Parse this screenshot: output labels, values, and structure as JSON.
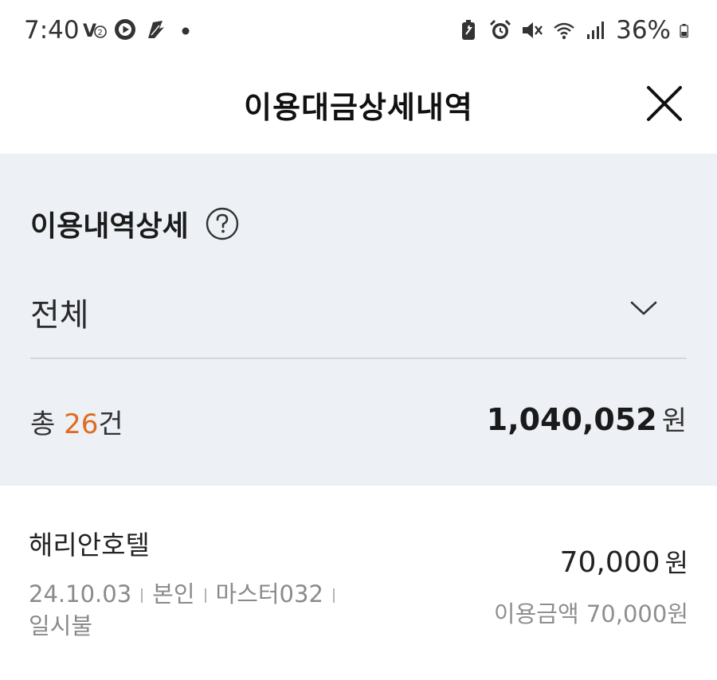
{
  "status_bar": {
    "time": "7:40",
    "battery_percent": "36%",
    "left_icons": [
      "volte-icon",
      "play-circle-icon",
      "app-icon",
      "dot-icon"
    ],
    "right_icons": [
      "battery-saver-icon",
      "alarm-icon",
      "mute-icon",
      "wifi-icon",
      "signal-icon",
      "battery-icon"
    ]
  },
  "header": {
    "title": "이용대금상세내역",
    "close_icon": "close-icon"
  },
  "summary": {
    "section_title": "이용내역상세",
    "help_icon": "question-circle-icon",
    "filter_value": "전체",
    "total_prefix": "총 ",
    "total_count": "26",
    "total_count_unit": "건",
    "total_amount": "1,040,052",
    "total_amount_unit": "원",
    "accent_color": "#e06a1f"
  },
  "transactions": [
    {
      "merchant": "해리안호텔",
      "date": "24.10.03",
      "owner": "본인",
      "card": "마스터032",
      "installment": "일시불",
      "amount": "70,000",
      "amount_unit": "원",
      "usage_amount": "이용금액 70,000원"
    }
  ]
}
